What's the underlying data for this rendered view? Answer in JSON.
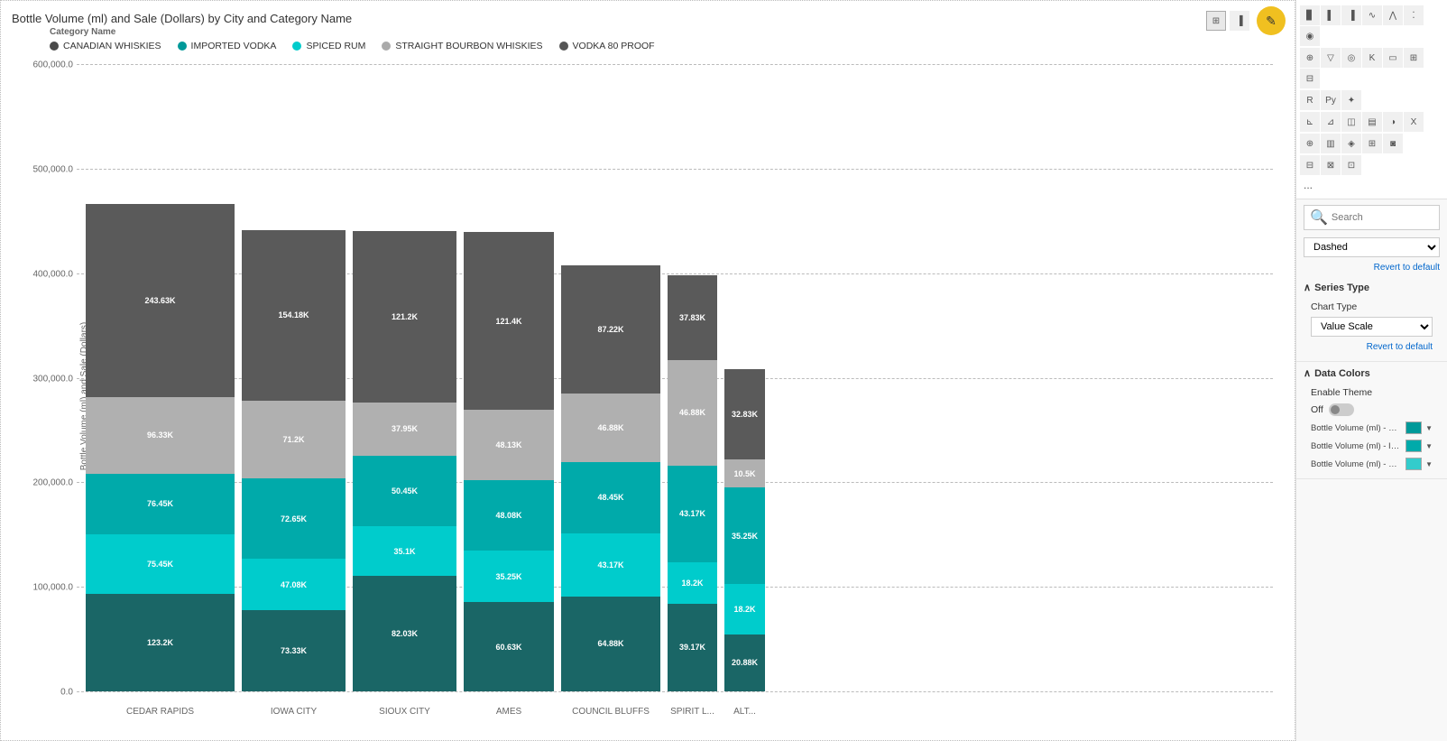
{
  "chart": {
    "title": "Bottle Volume (ml) and Sale (Dollars) by City and Category Name",
    "y_axis_label": "Bottle Volume (ml) and Sale (Dollars)",
    "legend_category": "Category Name",
    "legend_items": [
      {
        "label": "CANADIAN WHISKIES",
        "color": "#4a4a4a"
      },
      {
        "label": "IMPORTED VODKA",
        "color": "#009999"
      },
      {
        "label": "SPICED RUM",
        "color": "#00cccc"
      },
      {
        "label": "STRAIGHT BOURBON WHISKIES",
        "color": "#aaaaaa"
      },
      {
        "label": "VODKA 80 PROOF",
        "color": "#555555"
      }
    ],
    "y_axis": {
      "labels": [
        "600,000.0",
        "500,000.0",
        "400,000.0",
        "300,000.0",
        "200,000.0",
        "100,000.0",
        "0.0"
      ],
      "max": 600000
    },
    "cities": [
      {
        "name": "CEDAR RAPIDS",
        "segments": [
          {
            "label": "123.2K",
            "color": "#1a6666",
            "height_pct": 20.5
          },
          {
            "label": "75.45K",
            "color": "#00cccc",
            "height_pct": 12.6
          },
          {
            "label": "76.45K",
            "color": "#00aaaa",
            "height_pct": 12.7
          },
          {
            "label": "96.33K",
            "color": "#b0b0b0",
            "height_pct": 16.1
          },
          {
            "label": "243.63K",
            "color": "#5a5a5a",
            "height_pct": 40.6
          }
        ]
      },
      {
        "name": "IOWA CITY",
        "segments": [
          {
            "label": "73.33K",
            "color": "#1a6666",
            "height_pct": 17.0
          },
          {
            "label": "47.08K",
            "color": "#00cccc",
            "height_pct": 10.9
          },
          {
            "label": "72.65K",
            "color": "#00aaaa",
            "height_pct": 16.8
          },
          {
            "label": "71.2K",
            "color": "#b0b0b0",
            "height_pct": 16.5
          },
          {
            "label": "154.18K",
            "color": "#5a5a5a",
            "height_pct": 35.7
          }
        ]
      },
      {
        "name": "SIOUX CITY",
        "segments": [
          {
            "label": "82.03K",
            "color": "#1a6666",
            "height_pct": 24.3
          },
          {
            "label": "35.1K",
            "color": "#00cccc",
            "height_pct": 10.4
          },
          {
            "label": "50.45K",
            "color": "#00aaaa",
            "height_pct": 14.9
          },
          {
            "label": "37.95K",
            "color": "#b0b0b0",
            "height_pct": 11.2
          },
          {
            "label": "121.2K",
            "color": "#5a5a5a",
            "height_pct": 35.9
          }
        ]
      },
      {
        "name": "AMES",
        "segments": [
          {
            "label": "60.63K",
            "color": "#1a6666",
            "height_pct": 18.7
          },
          {
            "label": "35.25K",
            "color": "#00cccc",
            "height_pct": 10.9
          },
          {
            "label": "48.08K",
            "color": "#00aaaa",
            "height_pct": 14.8
          },
          {
            "label": "48.13K",
            "color": "#b0b0b0",
            "height_pct": 14.8
          },
          {
            "label": "121.4K",
            "color": "#5a5a5a",
            "height_pct": 37.4
          }
        ]
      },
      {
        "name": "COUNCIL BLUFFS",
        "segments": [
          {
            "label": "64.88K",
            "color": "#1a6666",
            "height_pct": 20.0
          },
          {
            "label": "43.17K",
            "color": "#00cccc",
            "height_pct": 13.3
          },
          {
            "label": "48.45K",
            "color": "#00aaaa",
            "height_pct": 14.9
          },
          {
            "label": "46.88K",
            "color": "#b0b0b0",
            "height_pct": 14.4
          },
          {
            "label": "87.22K",
            "color": "#5a5a5a",
            "height_pct": 26.9
          }
        ]
      },
      {
        "name": "SPIRIT L...",
        "segments": [
          {
            "label": "39.17K",
            "color": "#1a6666",
            "height_pct": 18.5
          },
          {
            "label": "18.2K",
            "color": "#00cccc",
            "height_pct": 8.6
          },
          {
            "label": "43.17K",
            "color": "#00aaaa",
            "height_pct": 20.4
          },
          {
            "label": "46.88K",
            "color": "#b0b0b0",
            "height_pct": 22.1
          },
          {
            "label": "37.83K",
            "color": "#5a5a5a",
            "height_pct": 17.9
          }
        ]
      },
      {
        "name": "ALT...",
        "segments": [
          {
            "label": "20.88K",
            "color": "#1a6666",
            "height_pct": 12.0
          },
          {
            "label": "18.2K",
            "color": "#00cccc",
            "height_pct": 10.5
          },
          {
            "label": "35.25K",
            "color": "#00aaaa",
            "height_pct": 20.3
          },
          {
            "label": "10.5K",
            "color": "#b0b0b0",
            "height_pct": 6.0
          },
          {
            "label": "32.83K",
            "color": "#5a5a5a",
            "height_pct": 18.9
          }
        ]
      }
    ]
  },
  "right_panel": {
    "search_placeholder": "Search",
    "dashed_label": "Dashed",
    "revert_label_1": "Revert to default",
    "series_type_label": "Series Type",
    "chart_type_label": "Chart Type",
    "chart_type_value": "Value Scale",
    "revert_label_2": "Revert to default",
    "data_colors_label": "Data Colors",
    "enable_theme_label": "Enable Theme",
    "toggle_state": "Off",
    "color_items": [
      {
        "label": "Bottle Volume (ml) - CAN...",
        "color": "#009999"
      },
      {
        "label": "Bottle Volume (ml) - IMP...",
        "color": "#00aaaa"
      },
      {
        "label": "Bottle Volume (ml) - SPIC...",
        "color": "#33cccc"
      }
    ],
    "more_dots": "..."
  }
}
